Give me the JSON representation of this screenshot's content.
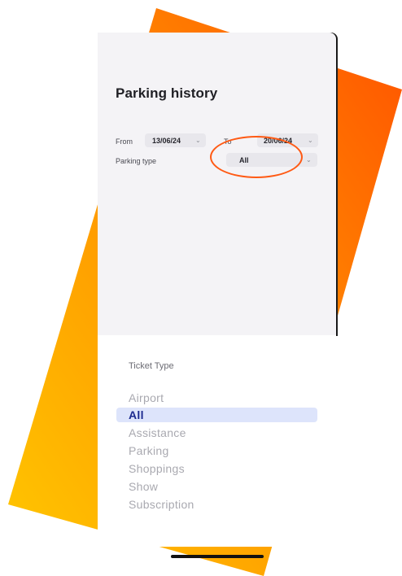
{
  "colors": {
    "accent": "#ff5a14",
    "selected_text": "#1b2a8f",
    "selected_bg": "#dde4fb"
  },
  "history": {
    "title": "Parking history",
    "from_label": "From",
    "from_value": "13/06/24",
    "to_label": "To",
    "to_value": "20/06/24",
    "type_label": "Parking type",
    "type_value": "All"
  },
  "ticket_type": {
    "title": "Ticket Type",
    "options": [
      "Airport",
      "All",
      "Assistance",
      "Parking",
      "Shoppings",
      "Show",
      "Subscription"
    ],
    "selected": "All"
  }
}
